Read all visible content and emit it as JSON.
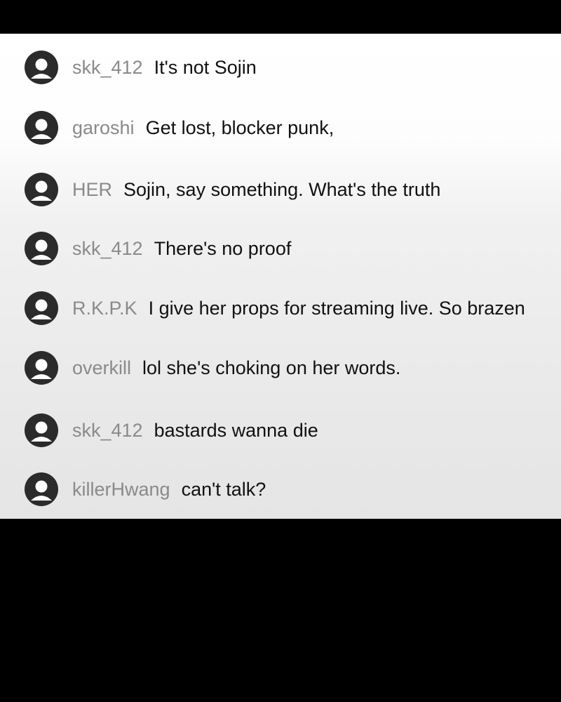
{
  "chat": {
    "avatar_icon": "user-avatar-icon",
    "colors": {
      "username": "#8a8a8a",
      "message": "#111111",
      "avatar": "#2b2b2b",
      "panel_top": "#ffffff",
      "panel_bottom": "#e5e5e5",
      "frame": "#000000"
    },
    "messages": [
      {
        "username": "skk_412",
        "text": "It's not Sojin"
      },
      {
        "username": "garoshi",
        "text": "Get lost, blocker punk,"
      },
      {
        "username": "HER",
        "text": "Sojin, say something. What's the truth"
      },
      {
        "username": "skk_412",
        "text": "There's no proof"
      },
      {
        "username": "R.K.P.K",
        "text": "I give her props for streaming live. So brazen"
      },
      {
        "username": "overkill",
        "text": "lol she's choking on her words."
      },
      {
        "username": "skk_412",
        "text": "bastards wanna die"
      },
      {
        "username": "killerHwang",
        "text": "can't talk?"
      }
    ]
  }
}
